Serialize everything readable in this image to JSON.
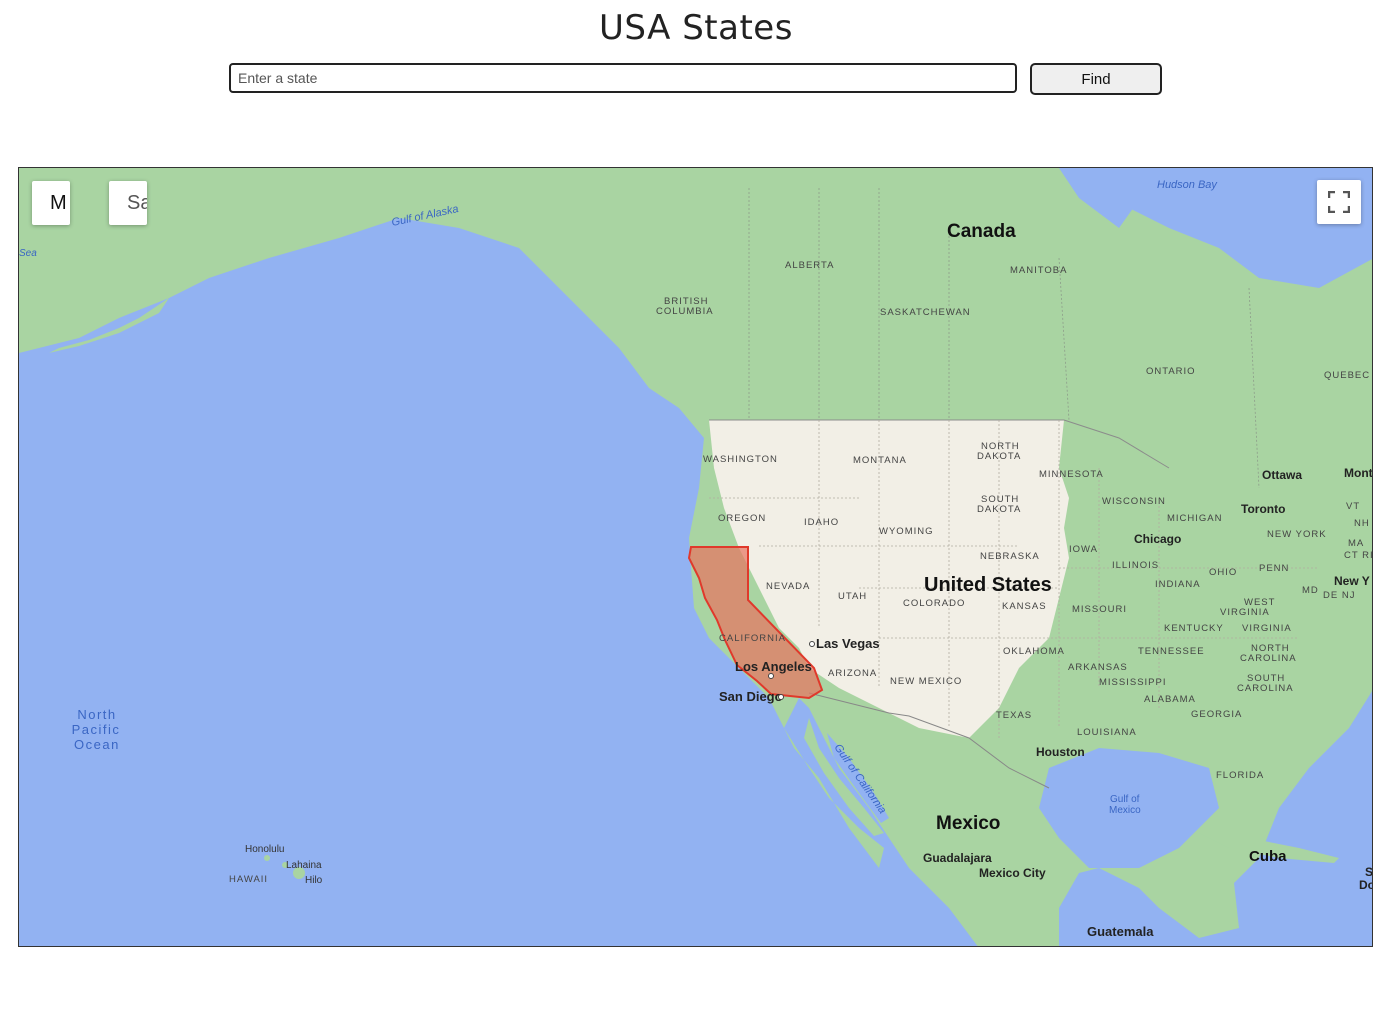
{
  "page": {
    "title": "USA States"
  },
  "search": {
    "placeholder": "Enter a state",
    "value": "",
    "button_label": "Find"
  },
  "map_controls": {
    "map_label": "M",
    "satellite_label": "Sa"
  },
  "highlighted_state": {
    "name": "CALIFORNIA",
    "fill": "#e8735f",
    "stroke": "#e0392b"
  },
  "colors": {
    "water": "#92b2f2",
    "land_green": "#a9d4a2",
    "land_us": "#f2efe6",
    "border": "#888888"
  },
  "labels": {
    "hudson_bay": "Hudson Bay",
    "canada": "Canada",
    "gulf_alaska": "Gulf of Alaska",
    "sea": "Sea",
    "alberta": "ALBERTA",
    "manitoba": "MANITOBA",
    "british_columbia_1": "BRITISH",
    "british_columbia_2": "COLUMBIA",
    "saskatchewan": "SASKATCHEWAN",
    "ontario": "ONTARIO",
    "quebec": "QUEBEC",
    "washington": "WASHINGTON",
    "montana": "MONTANA",
    "north_dakota_1": "NORTH",
    "north_dakota_2": "DAKOTA",
    "minnesota": "MINNESOTA",
    "ottawa": "Ottawa",
    "montreal": "Mont",
    "south_dakota_1": "SOUTH",
    "south_dakota_2": "DAKOTA",
    "wisconsin": "WISCONSIN",
    "vt": "VT",
    "oregon": "OREGON",
    "idaho": "IDAHO",
    "wyoming": "WYOMING",
    "michigan": "MICHIGAN",
    "toronto": "Toronto",
    "nh": "NH",
    "new_york": "NEW YORK",
    "ma": "MA",
    "iowa": "IOWA",
    "chicago": "Chicago",
    "ct_ri": "CT RI",
    "nebraska": "NEBRASKA",
    "nevada": "NEVADA",
    "illinois": "ILLINOIS",
    "ohio": "OHIO",
    "penn": "PENN",
    "united_states": "United States",
    "new_york_city": "New Y",
    "utah": "UTAH",
    "colorado": "COLORADO",
    "kansas": "KANSAS",
    "missouri": "MISSOURI",
    "indiana": "INDIANA",
    "md": "MD",
    "de_nj": "DE NJ",
    "west_virginia_1": "WEST",
    "west_virginia_2": "VIRGINIA",
    "california": "CALIFORNIA",
    "las_vegas": "Las Vegas",
    "kentucky": "KENTUCKY",
    "virginia": "VIRGINIA",
    "oklahoma": "OKLAHOMA",
    "tennessee": "TENNESSEE",
    "north_carolina_1": "NORTH",
    "north_carolina_2": "CAROLINA",
    "los_angeles": "Los Angeles",
    "arizona": "ARIZONA",
    "arkansas": "ARKANSAS",
    "new_mexico": "NEW MEXICO",
    "mississippi": "MISSISSIPPI",
    "south_carolina_1": "SOUTH",
    "south_carolina_2": "CAROLINA",
    "san_diego": "San Diego",
    "alabama": "ALABAMA",
    "texas": "TEXAS",
    "georgia": "GEORGIA",
    "north_pacific_1": "North",
    "north_pacific_2": "Pacific",
    "north_pacific_3": "Ocean",
    "louisiana": "LOUISIANA",
    "houston": "Houston",
    "gulf_california": "Gulf of California",
    "florida": "FLORIDA",
    "gulf_mexico_1": "Gulf of",
    "gulf_mexico_2": "Mexico",
    "mexico": "Mexico",
    "honolulu": "Honolulu",
    "lahaina": "Lahaina",
    "hawaii": "HAWAII",
    "hilo": "Hilo",
    "cuba": "Cuba",
    "guadalajara": "Guadalajara",
    "mexico_city": "Mexico City",
    "do": "Do",
    "s": "S",
    "guatemala": "Guatemala"
  }
}
